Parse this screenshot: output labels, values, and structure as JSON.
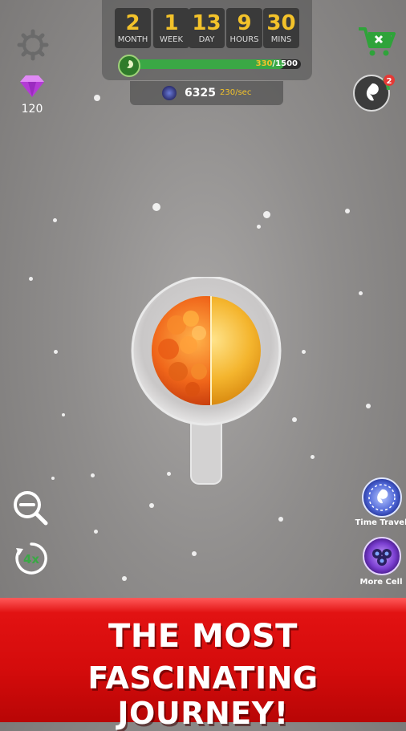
{
  "timer": [
    {
      "value": "2",
      "unit": "MONTH"
    },
    {
      "value": "1",
      "unit": "WEEK"
    },
    {
      "value": "13",
      "unit": "DAY"
    },
    {
      "value": "9",
      "unit": "HOURS"
    },
    {
      "value": "30",
      "unit": "MINS"
    }
  ],
  "progress": {
    "current": "330",
    "max": "1500",
    "fraction": 0.9
  },
  "cells": {
    "count": "6325",
    "rate": "230/sec"
  },
  "gems": {
    "count": "120"
  },
  "baby_badge": "2",
  "speed_label": "4x",
  "side_buttons": {
    "time_travel": "Time Travel",
    "more_cell": "More Cell"
  },
  "banner": {
    "line1": "THE MOST",
    "line2": "FASCINATING JOURNEY!"
  },
  "colors": {
    "accent_yellow": "#f3c22a",
    "progress_green": "#3aa845",
    "banner_red": "#d30b0b"
  },
  "icons": {
    "settings": "gear-icon",
    "gem": "gem-icon",
    "shop": "shopping-cart-icon",
    "baby": "fetus-icon",
    "zoom": "zoom-out-icon",
    "speed": "speed-icon",
    "time_travel": "time-travel-icon",
    "more_cell": "more-cell-icon"
  }
}
